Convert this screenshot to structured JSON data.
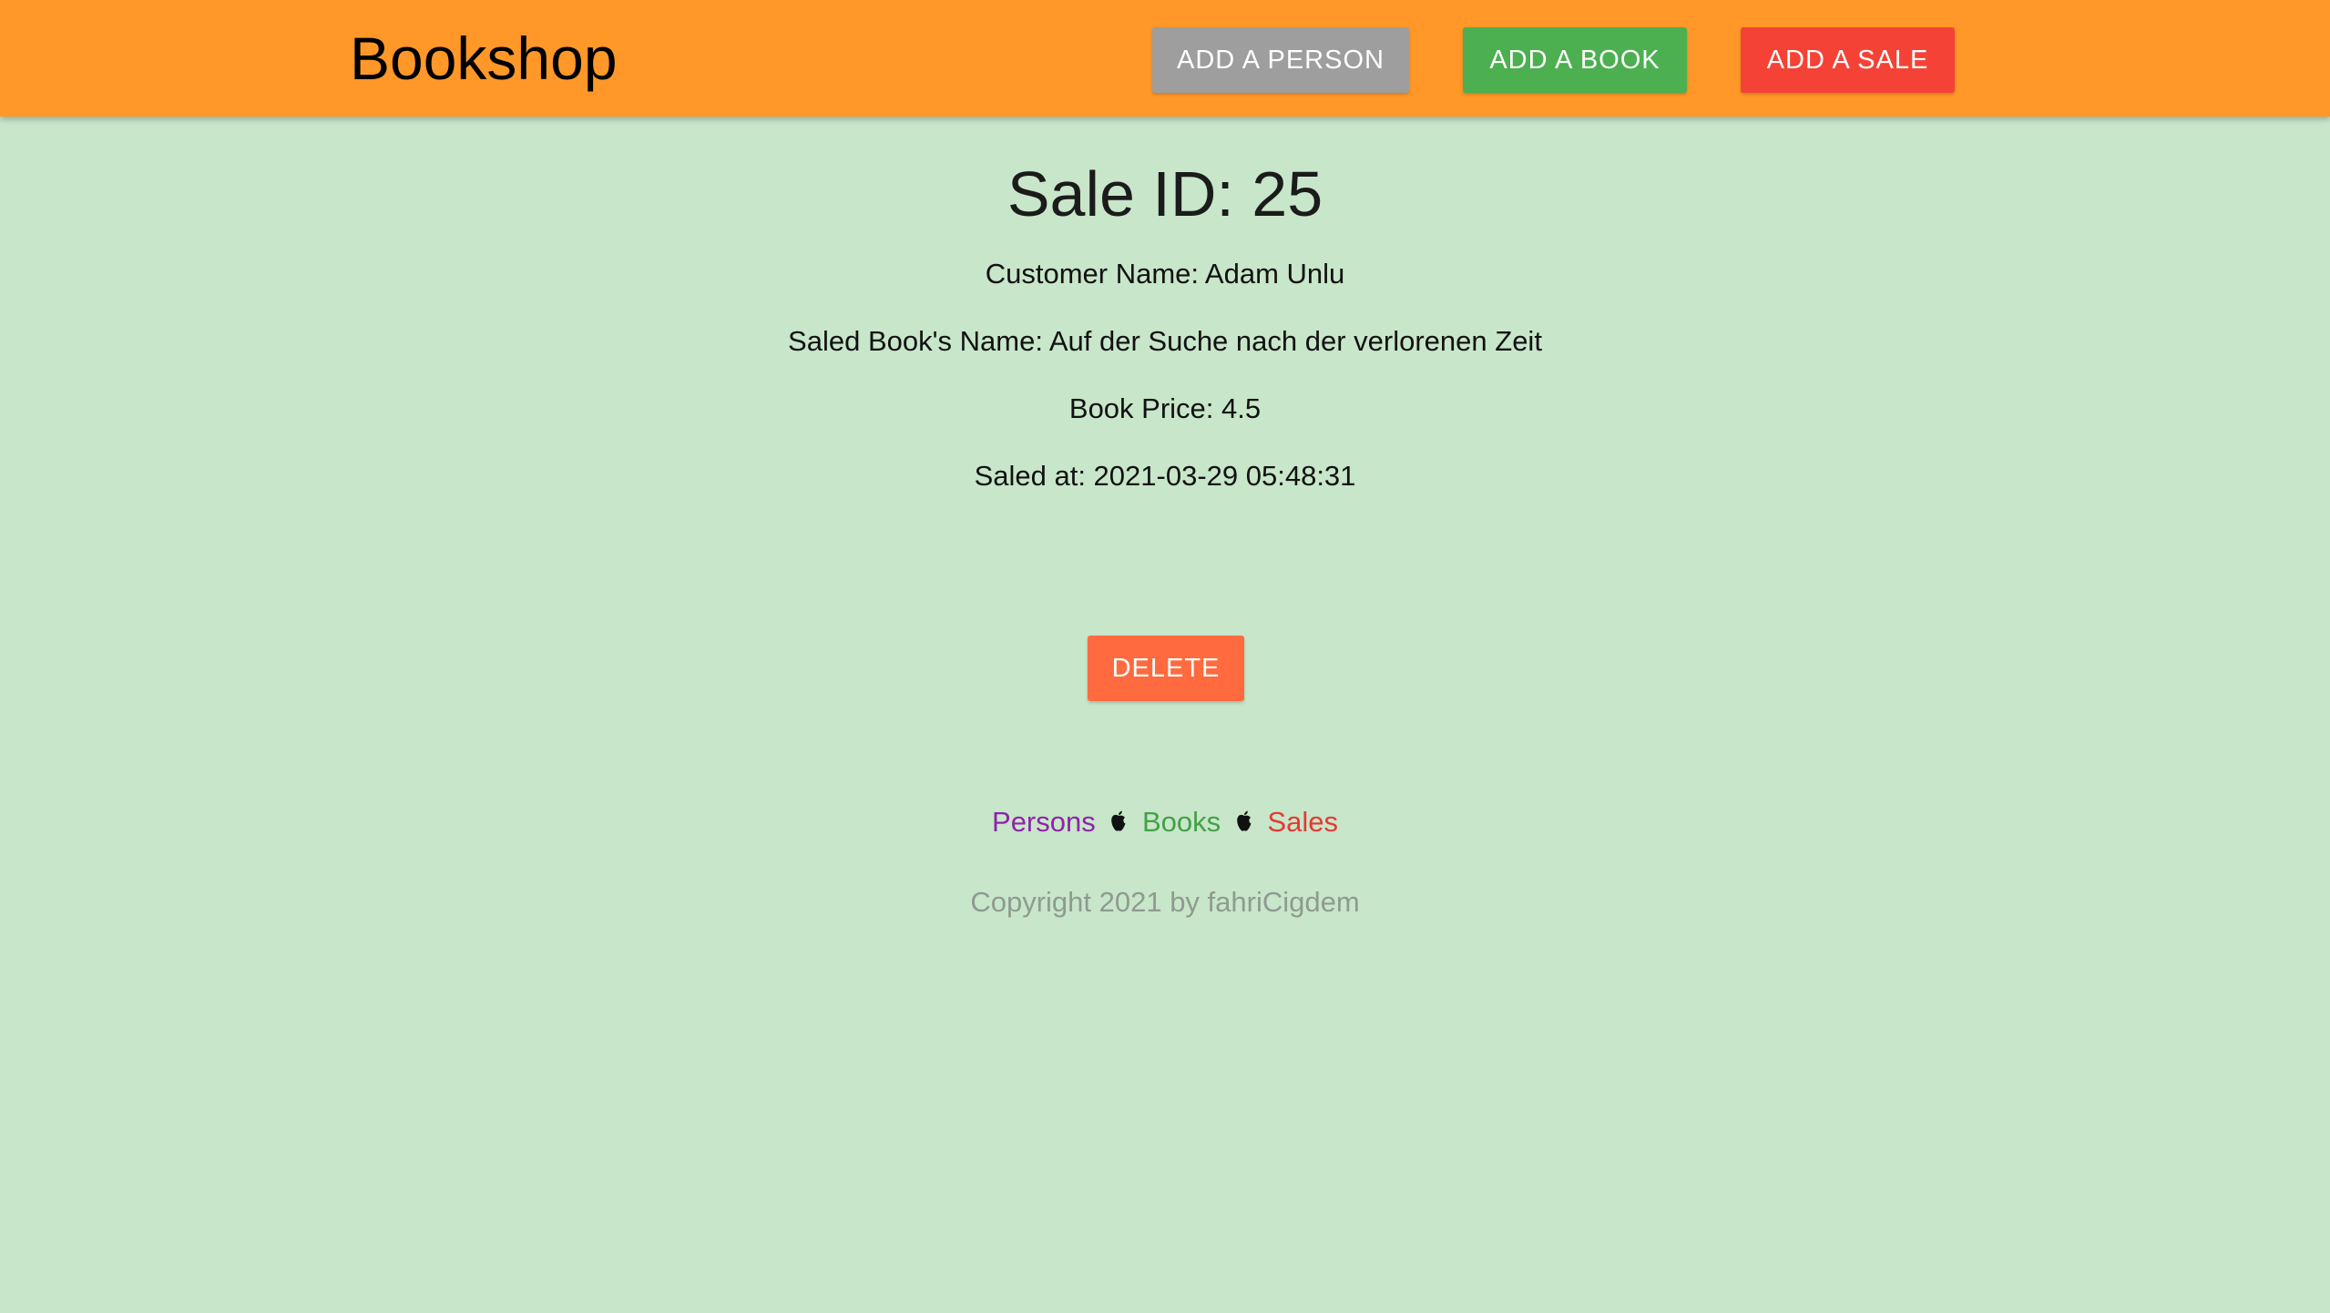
{
  "navbar": {
    "brand": "Bookshop",
    "buttons": [
      {
        "label": "ADD A PERSON",
        "color": "#9e9e9e"
      },
      {
        "label": "ADD A BOOK",
        "color": "#4caf50"
      },
      {
        "label": "ADD A SALE",
        "color": "#f44336"
      }
    ]
  },
  "sale": {
    "title": "Sale ID: 25",
    "customer": "Customer Name: Adam Unlu",
    "book": "Saled Book's Name: Auf der Suche nach der verlorenen Zeit",
    "price": "Book Price: 4.5",
    "saled_at": "Saled at: 2021-03-29 05:48:31"
  },
  "actions": {
    "delete_label": "DELETE",
    "delete_color": "#ff6a3e"
  },
  "footer": {
    "links": [
      {
        "label": "Persons",
        "color": "#8e24aa"
      },
      {
        "label": "Books",
        "color": "#43a047"
      },
      {
        "label": "Sales",
        "color": "#e53935"
      }
    ],
    "separator_icon": "apple-icon",
    "copyright": "Copyright 2021 by fahriCigdem"
  },
  "colors": {
    "navbar_bg": "#ff9828",
    "page_bg": "#c8e6c9"
  }
}
